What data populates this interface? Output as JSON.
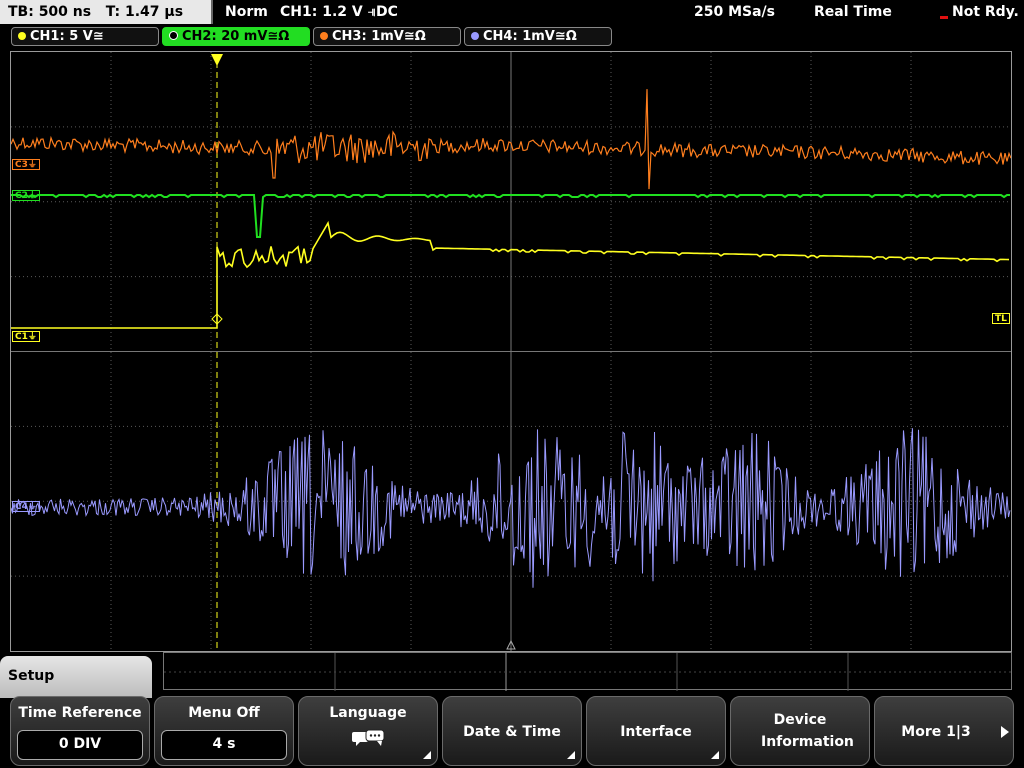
{
  "topbar": {
    "timebase": "TB: 500 ns",
    "trigger_time": "T: 1.47 µs",
    "mode": "Norm",
    "trigger": "CH1: 1.2 V ⫣DC",
    "sample_rate": "250 MSa/s",
    "acq_mode": "Real Time",
    "status": "Not Rdy."
  },
  "channels": [
    {
      "label": "CH1: 5 V≅",
      "color": "#ffff20",
      "active": false
    },
    {
      "label": "CH2: 20 mV≅Ω",
      "color": "#20e020",
      "active": true
    },
    {
      "label": "CH3: 1mV≅Ω",
      "color": "#ff7f1e",
      "active": false
    },
    {
      "label": "CH4: 1mV≅Ω",
      "color": "#9a9aff",
      "active": false
    }
  ],
  "markers": {
    "c3": "C3⏚",
    "c2": "C2⏚",
    "c1": "C1⏚",
    "c4": "C4⏚",
    "trigger_level": "TL"
  },
  "colors": {
    "ch1": "#ffff20",
    "ch2": "#20e020",
    "ch3": "#ff7f1e",
    "ch4": "#9a9aff",
    "grid": "#5a5a5a"
  },
  "menu": {
    "title": "Setup",
    "softkeys": [
      {
        "label": "Time Reference",
        "value": "0 DIV"
      },
      {
        "label": "Menu Off",
        "value": "4 s"
      },
      {
        "label": "Language",
        "icon": "speech-bubbles-icon"
      },
      {
        "label": "Date & Time"
      },
      {
        "label": "Interface"
      },
      {
        "label": "Device Information"
      },
      {
        "label": "More 1|3",
        "icon": "arrow-right-icon"
      }
    ]
  }
}
